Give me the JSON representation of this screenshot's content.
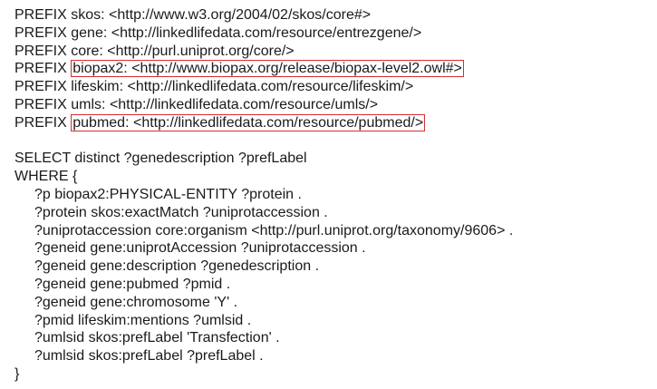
{
  "prefixes": [
    {
      "keyword": "PREFIX",
      "name": "skos:",
      "uri": "<http://www.w3.org/2004/02/skos/core#>",
      "highlighted": false
    },
    {
      "keyword": "PREFIX",
      "name": "gene:",
      "uri": "<http://linkedlifedata.com/resource/entrezgene/>",
      "highlighted": false
    },
    {
      "keyword": "PREFIX",
      "name": "core:",
      "uri": "<http://purl.uniprot.org/core/>",
      "highlighted": false
    },
    {
      "keyword": "PREFIX",
      "name": "biopax2:",
      "uri": "<http://www.biopax.org/release/biopax-level2.owl#>",
      "highlighted": true
    },
    {
      "keyword": "PREFIX",
      "name": "lifeskim:",
      "uri": "<http://linkedlifedata.com/resource/lifeskim/>",
      "highlighted": false
    },
    {
      "keyword": "PREFIX",
      "name": "umls:",
      "uri": "<http://linkedlifedata.com/resource/umls/>",
      "highlighted": false
    },
    {
      "keyword": "PREFIX",
      "name": "pubmed:",
      "uri": "<http://linkedlifedata.com/resource/pubmed/>",
      "highlighted": true
    }
  ],
  "select_line": "SELECT distinct ?genedescription ?prefLabel",
  "where_open": "WHERE {",
  "triples": [
    "?p biopax2:PHYSICAL-ENTITY ?protein .",
    "?protein skos:exactMatch ?uniprotaccession .",
    "?uniprotaccession core:organism <http://purl.uniprot.org/taxonomy/9606> .",
    "?geneid gene:uniprotAccession ?uniprotaccession .",
    "?geneid gene:description ?genedescription .",
    "?geneid gene:pubmed ?pmid .",
    "?geneid gene:chromosome 'Y' .",
    "?pmid lifeskim:mentions ?umlsid .",
    "?umlsid skos:prefLabel 'Transfection' .",
    "?umlsid skos:prefLabel ?prefLabel ."
  ],
  "where_close": "}",
  "colors": {
    "text": "#1a1a1a",
    "highlight_border": "#d3302f",
    "background": "#ffffff"
  }
}
